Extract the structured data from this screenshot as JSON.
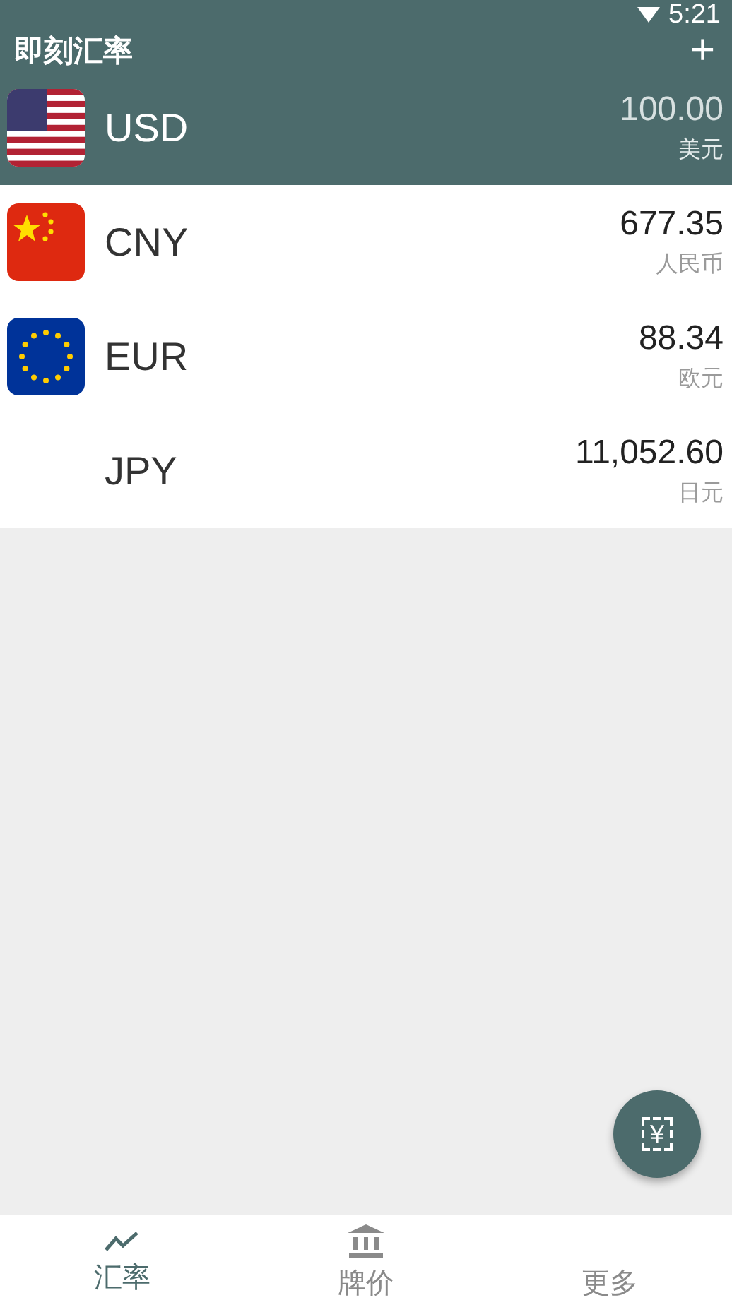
{
  "status_bar": {
    "time": "5:21"
  },
  "app_bar": {
    "title": "即刻汇率",
    "add_icon": "+"
  },
  "currencies": [
    {
      "code": "USD",
      "amount": "100.00",
      "name": "美元",
      "kind": "us",
      "selected": true
    },
    {
      "code": "CNY",
      "amount": "677.35",
      "name": "人民币",
      "kind": "cn",
      "selected": false
    },
    {
      "code": "EUR",
      "amount": "88.34",
      "name": "欧元",
      "kind": "eu",
      "selected": false
    },
    {
      "code": "JPY",
      "amount": "11,052.60",
      "name": "日元",
      "selected": false
    }
  ],
  "fab": {
    "label": "¥"
  },
  "bottom_nav": [
    {
      "label": "汇率",
      "kind": "chart",
      "selected": true
    },
    {
      "label": "牌价",
      "kind": "bank",
      "selected": false
    },
    {
      "label": "更多",
      "selected": false
    }
  ]
}
